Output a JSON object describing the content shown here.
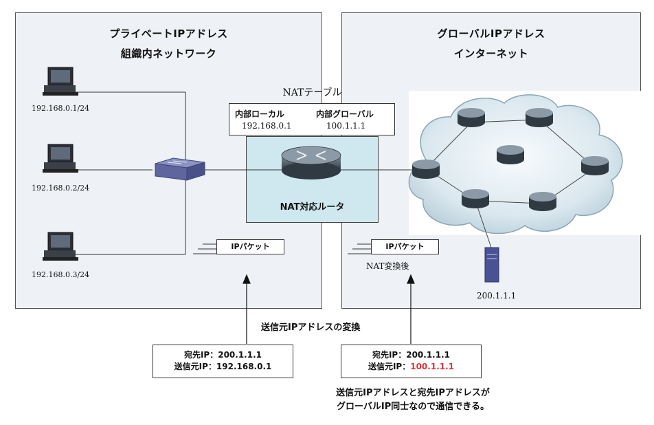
{
  "private_panel": {
    "title": "プライベートIPアドレス",
    "subtitle": "組織内ネットワーク"
  },
  "global_panel": {
    "title": "グローバルIPアドレス",
    "subtitle": "インターネット"
  },
  "hosts": [
    {
      "ip": "192.168.0.1/24"
    },
    {
      "ip": "192.168.0.2/24"
    },
    {
      "ip": "192.168.0.3/24"
    }
  ],
  "nat_table": {
    "title": "NATテーブル",
    "col_local": "内部ローカル",
    "col_global": "内部グローバル",
    "local_value": "192.168.0.1",
    "global_value": "100.1.1.1"
  },
  "router_label": "NAT対応ルータ",
  "packet_left": {
    "label": "IPパケット"
  },
  "packet_right": {
    "label": "IPパケット",
    "caption": "NAT変換後"
  },
  "server": {
    "ip": "200.1.1.1"
  },
  "conversion_label": "送信元IPアドレスの変換",
  "info_left": {
    "dest": "宛先IP：200.1.1.1",
    "src_prefix": "送信元IP：",
    "src_value": "192.168.0.1"
  },
  "info_right": {
    "dest": "宛先IP：200.1.1.1",
    "src_prefix": "送信元IP：",
    "src_value": "100.1.1.1"
  },
  "note": {
    "line1": "送信元IPアドレスと宛先IPアドレスが",
    "line2": "グローバルIP同士なので通信できる。"
  },
  "colors": {
    "highlight": "#e0313a",
    "panel": "#eef1f5",
    "router_box": "#cfe8ef"
  }
}
